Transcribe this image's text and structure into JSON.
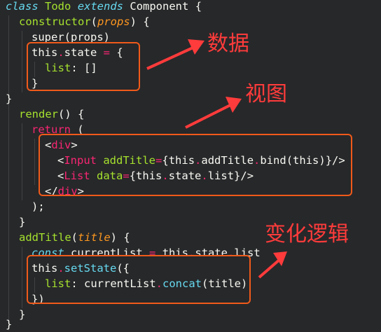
{
  "code": {
    "line1": {
      "kw_class": "class",
      "name": "Todo",
      "kw_extends": "extends",
      "base": "Component",
      "brace": " {"
    },
    "line2": {
      "fn": "constructor",
      "open": "(",
      "param": "props",
      "close": ") {"
    },
    "line3": {
      "text": "super(props)"
    },
    "line4": {
      "this": "this",
      "dot": ".",
      "prop": "state",
      "eq": " = ",
      "brace": "{"
    },
    "line5": {
      "key": "list",
      "colon": ": ",
      "val": "[]"
    },
    "line6": {
      "text": "}"
    },
    "line7": {
      "text": "}"
    },
    "line8": {
      "fn": "render",
      "rest": "() {"
    },
    "line9": {
      "kw": "return",
      "rest": " ("
    },
    "line10": {
      "open": "<",
      "tag": "div",
      "close": ">"
    },
    "line11": {
      "open": "<",
      "tag": "Input",
      "attr": " addTitle",
      "eq": "=",
      "expr_open": "{",
      "this": "this",
      "dot1": ".",
      "method": "addTitle",
      "dot2": ".",
      "bind": "bind",
      "args": "(this)",
      "expr_close": "}/>"
    },
    "line12": {
      "open": "<",
      "tag": "List",
      "attr": " data",
      "eq": "=",
      "expr_open": "{",
      "this": "this",
      "dot1": ".",
      "state": "state",
      "dot2": ".",
      "list": "list",
      "expr_close": "}/>"
    },
    "line13": {
      "open": "</",
      "tag": "div",
      "close": ">"
    },
    "line14": {
      "text": ");"
    },
    "line15": {
      "text": "}"
    },
    "line16": {
      "fn": "addTitle",
      "open": "(",
      "param": "title",
      "close": ") {"
    },
    "line17": {
      "kw": "const",
      "name": " currentList ",
      "eq": "=",
      "sp": " ",
      "this": "this",
      "dot1": ".",
      "state": "state",
      "dot2": ".",
      "list": "list"
    },
    "line18": {
      "this": "this",
      "dot": ".",
      "method": "setState",
      "rest": "({"
    },
    "line19": {
      "key": "list",
      "colon": ": ",
      "obj": "currentList",
      "dot": ".",
      "method": "concat",
      "args": "(title)"
    },
    "line20": {
      "text": "})"
    },
    "line21": {
      "text": "}"
    },
    "line22": {
      "text": "}"
    }
  },
  "annotations": {
    "data_label": "数据",
    "view_label": "视图",
    "logic_label": "变化逻辑"
  },
  "colors": {
    "background": "#27282a",
    "highlight_box": "#f05a1a",
    "annotation_red": "#ff3b3b",
    "keyword_pink": "#f92672",
    "function_green": "#a6e22e",
    "keyword_cyan": "#66d9ef",
    "param_orange": "#fd971f"
  }
}
